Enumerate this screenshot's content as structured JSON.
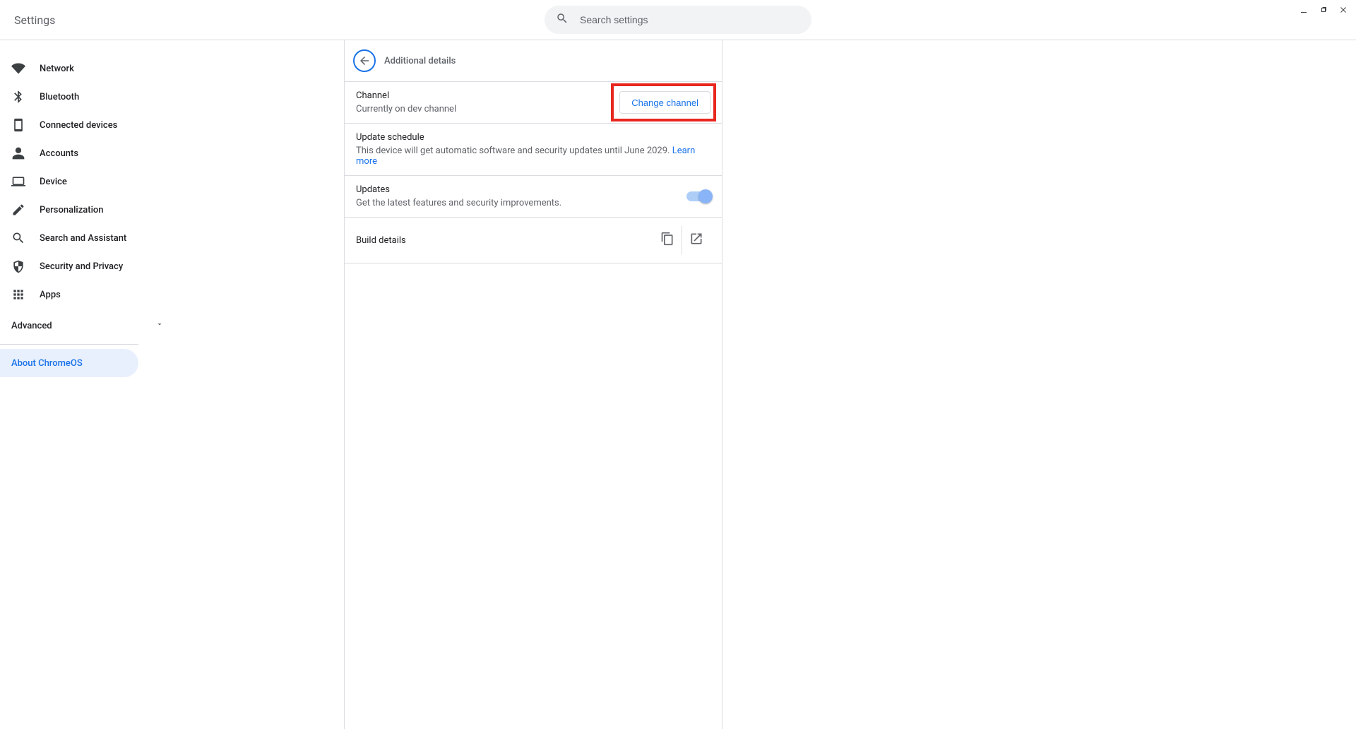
{
  "app_title": "Settings",
  "search": {
    "placeholder": "Search settings"
  },
  "sidebar": {
    "items": [
      {
        "label": "Network"
      },
      {
        "label": "Bluetooth"
      },
      {
        "label": "Connected devices"
      },
      {
        "label": "Accounts"
      },
      {
        "label": "Device"
      },
      {
        "label": "Personalization"
      },
      {
        "label": "Search and Assistant"
      },
      {
        "label": "Security and Privacy"
      },
      {
        "label": "Apps"
      }
    ],
    "advanced_label": "Advanced",
    "about_label": "About ChromeOS"
  },
  "panel": {
    "title": "Additional details",
    "channel": {
      "label": "Channel",
      "sub": "Currently on dev channel",
      "button": "Change channel"
    },
    "schedule": {
      "label": "Update schedule",
      "sub_pre": "This device will get automatic software and security updates until June 2029. ",
      "link": "Learn more"
    },
    "updates": {
      "label": "Updates",
      "sub": "Get the latest features and security improvements."
    },
    "build": {
      "label": "Build details"
    }
  }
}
